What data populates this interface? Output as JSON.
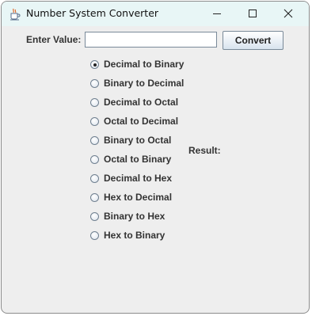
{
  "window": {
    "title": "Number System Converter"
  },
  "form": {
    "enter_label": "Enter Value:",
    "input_value": "",
    "input_placeholder": "",
    "convert_label": "Convert"
  },
  "options": [
    {
      "label": "Decimal to Binary",
      "selected": true
    },
    {
      "label": "Binary to Decimal",
      "selected": false
    },
    {
      "label": "Decimal to Octal",
      "selected": false
    },
    {
      "label": "Octal to Decimal",
      "selected": false
    },
    {
      "label": "Binary to Octal",
      "selected": false
    },
    {
      "label": "Octal to Binary",
      "selected": false
    },
    {
      "label": "Decimal to Hex",
      "selected": false
    },
    {
      "label": "Hex to Decimal",
      "selected": false
    },
    {
      "label": "Binary to Hex",
      "selected": false
    },
    {
      "label": "Hex to Binary",
      "selected": false
    }
  ],
  "result": {
    "label": "Result:"
  },
  "icons": {
    "app": "java-cup-icon",
    "minimize": "minimize-icon",
    "maximize": "maximize-icon",
    "close": "close-icon"
  }
}
